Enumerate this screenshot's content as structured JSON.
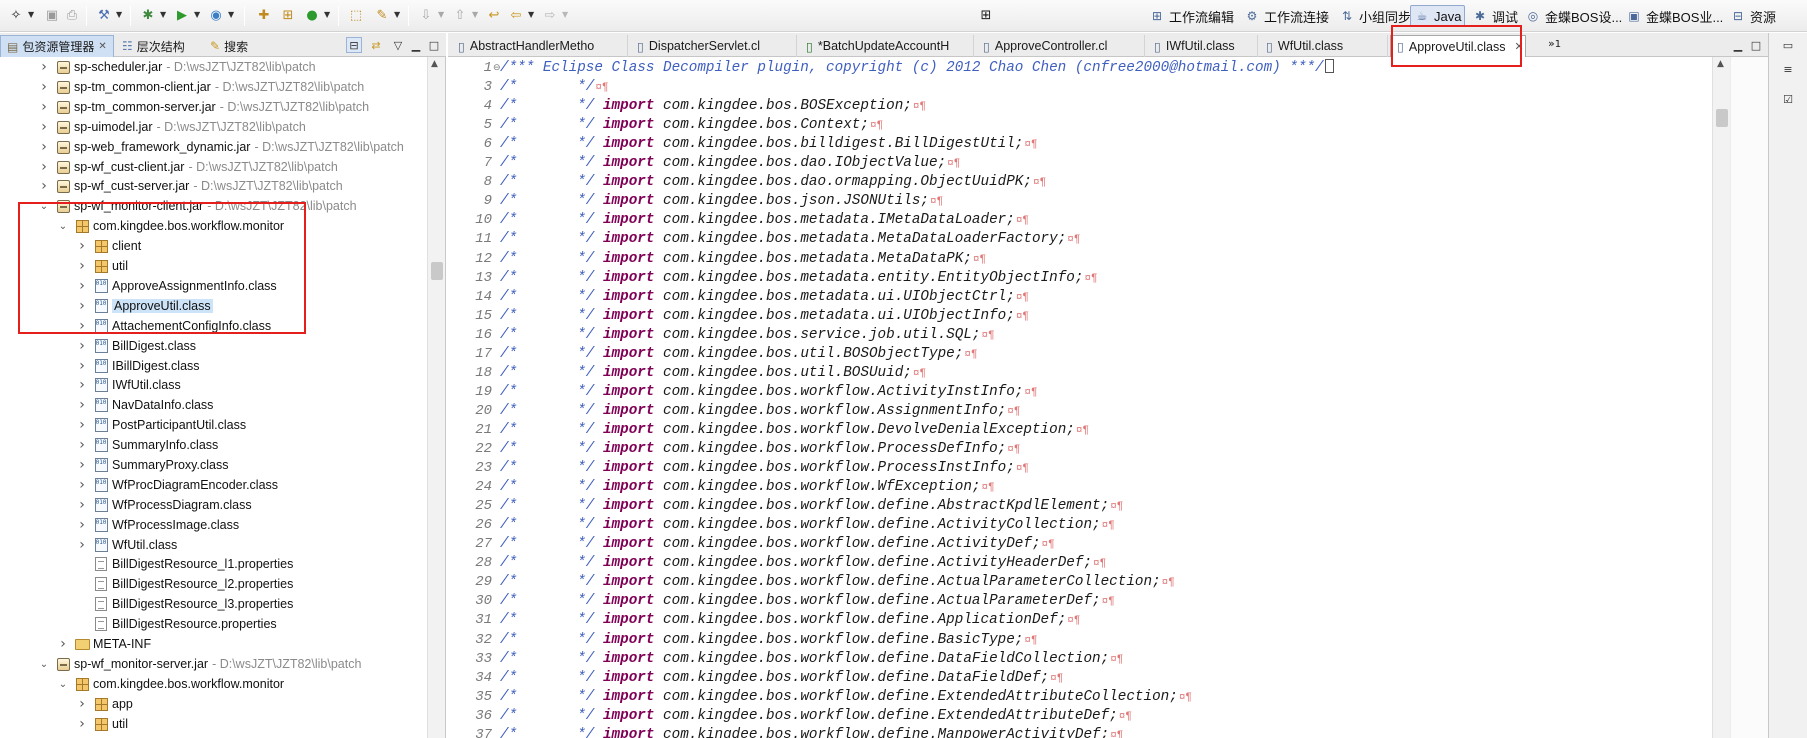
{
  "toolbar": {
    "perspectives": [
      {
        "label": "工作流编辑",
        "icon": "workflow-edit-icon"
      },
      {
        "label": "工作流连接",
        "icon": "workflow-connect-icon"
      },
      {
        "label": "小组同步",
        "icon": "team-sync-icon"
      },
      {
        "label": "Java",
        "icon": "java-perspective-icon",
        "active": true
      },
      {
        "label": "调试",
        "icon": "debug-perspective-icon"
      },
      {
        "label": "金蝶BOS设...",
        "icon": "kingdee-bos-design-icon"
      },
      {
        "label": "金蝶BOS业...",
        "icon": "kingdee-bos-business-icon"
      },
      {
        "label": "资源",
        "icon": "resource-perspective-icon"
      }
    ]
  },
  "left_view": {
    "tabs": [
      {
        "label": "包资源管理器",
        "icon": "package-explorer-icon",
        "active": true
      },
      {
        "label": "层次结构",
        "icon": "hierarchy-icon"
      },
      {
        "label": "搜索",
        "icon": "search-icon"
      }
    ],
    "tree": [
      {
        "depth": 0,
        "toggle": "collapsed",
        "icon": "jar",
        "name": "sp-scheduler.jar",
        "path": "- D:\\wsJZT\\JZT82\\lib\\patch"
      },
      {
        "depth": 0,
        "toggle": "collapsed",
        "icon": "jar",
        "name": "sp-tm_common-client.jar",
        "path": "- D:\\wsJZT\\JZT82\\lib\\patch"
      },
      {
        "depth": 0,
        "toggle": "collapsed",
        "icon": "jar",
        "name": "sp-tm_common-server.jar",
        "path": "- D:\\wsJZT\\JZT82\\lib\\patch"
      },
      {
        "depth": 0,
        "toggle": "collapsed",
        "icon": "jar",
        "name": "sp-uimodel.jar",
        "path": "- D:\\wsJZT\\JZT82\\lib\\patch"
      },
      {
        "depth": 0,
        "toggle": "collapsed",
        "icon": "jar",
        "name": "sp-web_framework_dynamic.jar",
        "path": "- D:\\wsJZT\\JZT82\\lib\\patch"
      },
      {
        "depth": 0,
        "toggle": "collapsed",
        "icon": "jar",
        "name": "sp-wf_cust-client.jar",
        "path": "- D:\\wsJZT\\JZT82\\lib\\patch"
      },
      {
        "depth": 0,
        "toggle": "collapsed",
        "icon": "jar",
        "name": "sp-wf_cust-server.jar",
        "path": "- D:\\wsJZT\\JZT82\\lib\\patch"
      },
      {
        "depth": 0,
        "toggle": "expanded",
        "icon": "jar",
        "name": "sp-wf_monitor-client.jar",
        "path": "- D:\\wsJZT\\JZT82\\lib\\patch"
      },
      {
        "depth": 1,
        "toggle": "expanded",
        "icon": "package",
        "name": "com.kingdee.bos.workflow.monitor",
        "path": ""
      },
      {
        "depth": 2,
        "toggle": "collapsed",
        "icon": "package",
        "name": "client",
        "path": ""
      },
      {
        "depth": 2,
        "toggle": "collapsed",
        "icon": "package",
        "name": "util",
        "path": ""
      },
      {
        "depth": 2,
        "toggle": "collapsed",
        "icon": "class",
        "name": "ApproveAssignmentInfo.class",
        "path": ""
      },
      {
        "depth": 2,
        "toggle": "collapsed",
        "icon": "class",
        "name": "ApproveUtil.class",
        "path": "",
        "selected": true
      },
      {
        "depth": 2,
        "toggle": "collapsed",
        "icon": "class",
        "name": "AttachementConfigInfo.class",
        "path": ""
      },
      {
        "depth": 2,
        "toggle": "collapsed",
        "icon": "class",
        "name": "BillDigest.class",
        "path": ""
      },
      {
        "depth": 2,
        "toggle": "collapsed",
        "icon": "class",
        "name": "IBillDigest.class",
        "path": ""
      },
      {
        "depth": 2,
        "toggle": "collapsed",
        "icon": "class",
        "name": "IWfUtil.class",
        "path": ""
      },
      {
        "depth": 2,
        "toggle": "collapsed",
        "icon": "class",
        "name": "NavDataInfo.class",
        "path": ""
      },
      {
        "depth": 2,
        "toggle": "collapsed",
        "icon": "class",
        "name": "PostParticipantUtil.class",
        "path": ""
      },
      {
        "depth": 2,
        "toggle": "collapsed",
        "icon": "class",
        "name": "SummaryInfo.class",
        "path": ""
      },
      {
        "depth": 2,
        "toggle": "collapsed",
        "icon": "class",
        "name": "SummaryProxy.class",
        "path": ""
      },
      {
        "depth": 2,
        "toggle": "collapsed",
        "icon": "class",
        "name": "WfProcDiagramEncoder.class",
        "path": ""
      },
      {
        "depth": 2,
        "toggle": "collapsed",
        "icon": "class",
        "name": "WfProcessDiagram.class",
        "path": ""
      },
      {
        "depth": 2,
        "toggle": "collapsed",
        "icon": "class",
        "name": "WfProcessImage.class",
        "path": ""
      },
      {
        "depth": 2,
        "toggle": "collapsed",
        "icon": "class",
        "name": "WfUtil.class",
        "path": ""
      },
      {
        "depth": 2,
        "toggle": "none",
        "icon": "properties",
        "name": "BillDigestResource_l1.properties",
        "path": ""
      },
      {
        "depth": 2,
        "toggle": "none",
        "icon": "properties",
        "name": "BillDigestResource_l2.properties",
        "path": ""
      },
      {
        "depth": 2,
        "toggle": "none",
        "icon": "properties",
        "name": "BillDigestResource_l3.properties",
        "path": ""
      },
      {
        "depth": 2,
        "toggle": "none",
        "icon": "properties",
        "name": "BillDigestResource.properties",
        "path": ""
      },
      {
        "depth": 1,
        "toggle": "collapsed",
        "icon": "folder",
        "name": "META-INF",
        "path": ""
      },
      {
        "depth": 0,
        "toggle": "expanded",
        "icon": "jar",
        "name": "sp-wf_monitor-server.jar",
        "path": "- D:\\wsJZT\\JZT82\\lib\\patch"
      },
      {
        "depth": 1,
        "toggle": "expanded",
        "icon": "package",
        "name": "com.kingdee.bos.workflow.monitor",
        "path": ""
      },
      {
        "depth": 2,
        "toggle": "collapsed",
        "icon": "package",
        "name": "app",
        "path": ""
      },
      {
        "depth": 2,
        "toggle": "collapsed",
        "icon": "package",
        "name": "util",
        "path": ""
      }
    ]
  },
  "editor": {
    "tabs": [
      {
        "label": "AbstractHandlerMetho",
        "icon": "class-file-icon"
      },
      {
        "label": "DispatcherServlet.cl",
        "icon": "class-file-icon"
      },
      {
        "label": "*BatchUpdateAccountH",
        "icon": "java-file-icon"
      },
      {
        "label": "ApproveController.cl",
        "icon": "class-file-icon"
      },
      {
        "label": "IWfUtil.class",
        "icon": "class-file-icon"
      },
      {
        "label": "WfUtil.class",
        "icon": "class-file-icon"
      },
      {
        "label": "ApproveUtil.class",
        "icon": "class-file-icon",
        "active": true
      }
    ],
    "overflow_count": "1",
    "header_comment": "/*** Eclipse Class Decompiler plugin, copyright (c) 2012 Chao Chen (cnfree2000@hotmail.com) ***/",
    "empty_comment": "/*       */",
    "import_prefix": "/*       */ ",
    "import_keyword": "import",
    "eol_marker": "¤¶",
    "lines": [
      {
        "n": "1",
        "kind": "header"
      },
      {
        "n": "3",
        "kind": "empty"
      },
      {
        "n": "4",
        "kind": "import",
        "text": "com.kingdee.bos.BOSException;"
      },
      {
        "n": "5",
        "kind": "import",
        "text": "com.kingdee.bos.Context;"
      },
      {
        "n": "6",
        "kind": "import",
        "text": "com.kingdee.bos.billdigest.BillDigestUtil;"
      },
      {
        "n": "7",
        "kind": "import",
        "text": "com.kingdee.bos.dao.IObjectValue;"
      },
      {
        "n": "8",
        "kind": "import",
        "text": "com.kingdee.bos.dao.ormapping.ObjectUuidPK;"
      },
      {
        "n": "9",
        "kind": "import",
        "text": "com.kingdee.bos.json.JSONUtils;"
      },
      {
        "n": "10",
        "kind": "import",
        "text": "com.kingdee.bos.metadata.IMetaDataLoader;"
      },
      {
        "n": "11",
        "kind": "import",
        "text": "com.kingdee.bos.metadata.MetaDataLoaderFactory;"
      },
      {
        "n": "12",
        "kind": "import",
        "text": "com.kingdee.bos.metadata.MetaDataPK;"
      },
      {
        "n": "13",
        "kind": "import",
        "text": "com.kingdee.bos.metadata.entity.EntityObjectInfo;"
      },
      {
        "n": "14",
        "kind": "import",
        "text": "com.kingdee.bos.metadata.ui.UIObjectCtrl;"
      },
      {
        "n": "15",
        "kind": "import",
        "text": "com.kingdee.bos.metadata.ui.UIObjectInfo;"
      },
      {
        "n": "16",
        "kind": "import",
        "text": "com.kingdee.bos.service.job.util.SQL;"
      },
      {
        "n": "17",
        "kind": "import",
        "text": "com.kingdee.bos.util.BOSObjectType;"
      },
      {
        "n": "18",
        "kind": "import",
        "text": "com.kingdee.bos.util.BOSUuid;"
      },
      {
        "n": "19",
        "kind": "import",
        "text": "com.kingdee.bos.workflow.ActivityInstInfo;"
      },
      {
        "n": "20",
        "kind": "import",
        "text": "com.kingdee.bos.workflow.AssignmentInfo;"
      },
      {
        "n": "21",
        "kind": "import",
        "text": "com.kingdee.bos.workflow.DevolveDenialException;"
      },
      {
        "n": "22",
        "kind": "import",
        "text": "com.kingdee.bos.workflow.ProcessDefInfo;"
      },
      {
        "n": "23",
        "kind": "import",
        "text": "com.kingdee.bos.workflow.ProcessInstInfo;"
      },
      {
        "n": "24",
        "kind": "import",
        "text": "com.kingdee.bos.workflow.WfException;"
      },
      {
        "n": "25",
        "kind": "import",
        "text": "com.kingdee.bos.workflow.define.AbstractKpdlElement;"
      },
      {
        "n": "26",
        "kind": "import",
        "text": "com.kingdee.bos.workflow.define.ActivityCollection;"
      },
      {
        "n": "27",
        "kind": "import",
        "text": "com.kingdee.bos.workflow.define.ActivityDef;"
      },
      {
        "n": "28",
        "kind": "import",
        "text": "com.kingdee.bos.workflow.define.ActivityHeaderDef;"
      },
      {
        "n": "29",
        "kind": "import",
        "text": "com.kingdee.bos.workflow.define.ActualParameterCollection;"
      },
      {
        "n": "30",
        "kind": "import",
        "text": "com.kingdee.bos.workflow.define.ActualParameterDef;"
      },
      {
        "n": "31",
        "kind": "import",
        "text": "com.kingdee.bos.workflow.define.ApplicationDef;"
      },
      {
        "n": "32",
        "kind": "import",
        "text": "com.kingdee.bos.workflow.define.BasicType;"
      },
      {
        "n": "33",
        "kind": "import",
        "text": "com.kingdee.bos.workflow.define.DataFieldCollection;"
      },
      {
        "n": "34",
        "kind": "import",
        "text": "com.kingdee.bos.workflow.define.DataFieldDef;"
      },
      {
        "n": "35",
        "kind": "import",
        "text": "com.kingdee.bos.workflow.define.ExtendedAttributeCollection;"
      },
      {
        "n": "36",
        "kind": "import",
        "text": "com.kingdee.bos.workflow.define.ExtendedAttributeDef;"
      },
      {
        "n": "37",
        "kind": "import",
        "text": "com.kingdee.bos.workflow.define.ManpowerActivityDef;"
      }
    ]
  },
  "colors": {
    "comment": "#3f5fbf",
    "keyword": "#7f0055",
    "highlight": "#e5201c",
    "selection": "#cde3f8"
  }
}
